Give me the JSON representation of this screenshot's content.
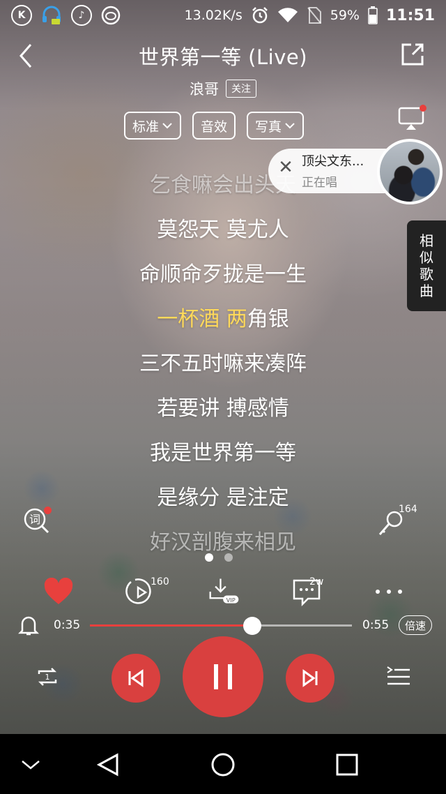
{
  "status_bar": {
    "net_speed": "13.02K/s",
    "battery": "59%",
    "time": "11:51",
    "left_icons": [
      "k-app-icon",
      "headset-icon",
      "clef-icon",
      "weibo-icon"
    ],
    "right_icons": [
      "alarm-icon",
      "wifi-icon",
      "no-sim-icon",
      "battery-icon"
    ]
  },
  "header": {
    "title": "世界第一等 (Live)",
    "artist": "浪哥",
    "follow_label": "关注"
  },
  "modes": {
    "quality": "标准",
    "effects": "音效",
    "photo": "写真"
  },
  "now_singing": {
    "name": "顶尖文东...",
    "status": "正在唱"
  },
  "similar_tab": [
    "相",
    "似",
    "歌",
    "曲"
  ],
  "lyrics": {
    "lines": [
      "乞食嘛会出头天",
      "莫怨天 莫尤人",
      "命顺命歹拢是一生",
      "一杯酒 两角银",
      "三不五时嘛来凑阵",
      "若要讲 搏感情",
      "我是世界第一等",
      "是缘分 是注定",
      "好汉剖腹来相见"
    ],
    "current_index": 3,
    "current_sung": "一杯酒 两",
    "current_rest": "角银"
  },
  "lyric_button_label": "词",
  "mic_count": "164",
  "action_counts": {
    "comments_video": "160",
    "comments": "2w",
    "vip_label": "VIP"
  },
  "progress": {
    "current": "0:35",
    "total": "0:55",
    "fraction": 0.62,
    "speed_label": "倍速"
  },
  "colors": {
    "accent": "#e8403d",
    "lyric_highlight": "#ffd95a"
  },
  "pager": {
    "pages": 2,
    "active": 0
  }
}
